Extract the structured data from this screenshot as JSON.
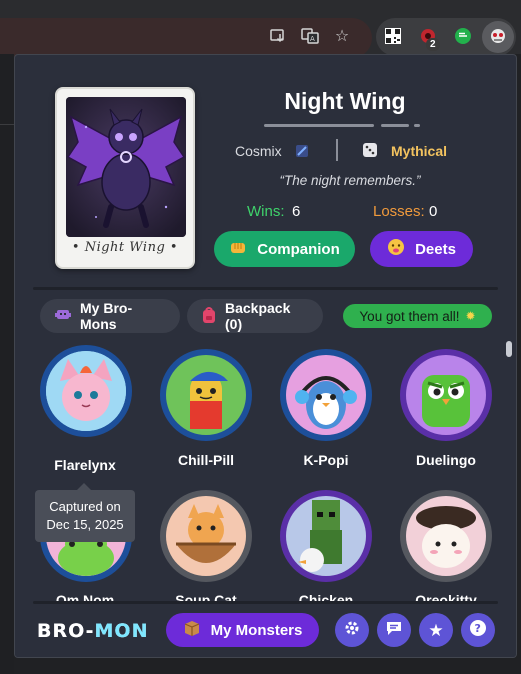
{
  "browser": {
    "extension_badge": "2"
  },
  "featured": {
    "name": "Night Wing",
    "card_label": "• Night Wing •",
    "set": "Cosmix",
    "rarity": "Mythical",
    "quote": "“The night remembers.”",
    "wins_label": "Wins:",
    "wins": "6",
    "losses_label": "Losses:",
    "losses": "0",
    "companion_button": "Companion",
    "deets_button": "Deets"
  },
  "tabs": {
    "mine": "My Bro-Mons",
    "backpack": "Backpack (0)",
    "status": "You got them all!"
  },
  "monsters": [
    {
      "name": "Flarelynx"
    },
    {
      "name": "Chill-Pill"
    },
    {
      "name": "K-Popi"
    },
    {
      "name": "Duelingo"
    },
    {
      "name": "Om Nom"
    },
    {
      "name": "Soup Cat"
    },
    {
      "name": "Chicken"
    },
    {
      "name": "Oreokitty"
    }
  ],
  "tooltip": {
    "line1": "Captured on",
    "line2": "Dec 15, 2025"
  },
  "footer": {
    "logo_left": "BRO-",
    "logo_right": "MON",
    "monsters_button": "My Monsters"
  },
  "colors": {
    "accent_purple": "#6d2bd9",
    "accent_green": "#1aa86b",
    "rarity_gold": "#f3c35f",
    "wins_green": "#3fd26b",
    "losses_orange": "#f09a3c"
  }
}
